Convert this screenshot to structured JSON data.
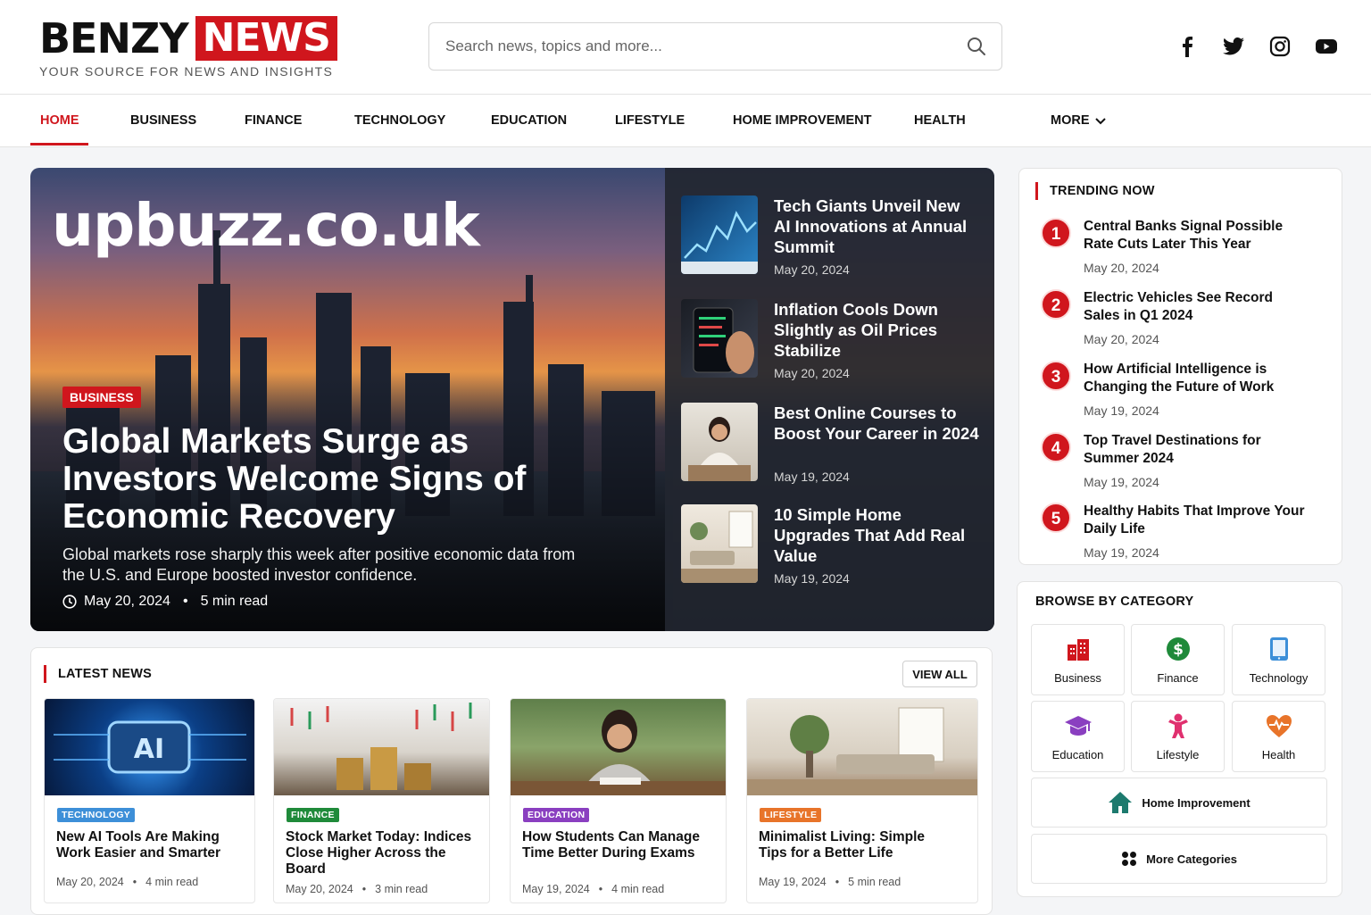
{
  "brand": {
    "name_dark": "BENZY",
    "name_red": "NEWS",
    "tagline": "YOUR SOURCE FOR NEWS AND INSIGHTS"
  },
  "search": {
    "placeholder": "Search news, topics and more..."
  },
  "social": [
    "facebook-icon",
    "twitter-icon",
    "instagram-icon",
    "youtube-icon"
  ],
  "nav": {
    "items": [
      "HOME",
      "BUSINESS",
      "FINANCE",
      "TECHNOLOGY",
      "EDUCATION",
      "LIFESTYLE",
      "HOME IMPROVEMENT",
      "HEALTH",
      "MORE"
    ],
    "active": "HOME"
  },
  "hero": {
    "watermark": "upbuzz.co.uk",
    "category": "BUSINESS",
    "title": "Global Markets Surge as Investors Welcome Signs of Economic Recovery",
    "description": "Global markets rose sharply this week after positive economic data from the U.S. and Europe boosted investor confidence.",
    "date": "May 20, 2024",
    "read_time": "5 min read",
    "side": [
      {
        "title": "Tech Giants Unveil New AI Innovations at Annual Summit",
        "date": "May 20, 2024"
      },
      {
        "title": "Inflation Cools Down Slightly as Oil Prices Stabilize",
        "date": "May 20, 2024"
      },
      {
        "title": "Best Online Courses to Boost Your Career in 2024",
        "date": "May 19, 2024"
      },
      {
        "title": "10 Simple Home Upgrades That Add Real Value",
        "date": "May 19, 2024"
      }
    ]
  },
  "latest": {
    "heading": "LATEST NEWS",
    "view_all": "VIEW ALL",
    "cards": [
      {
        "tag": "TECHNOLOGY",
        "title": "New AI Tools Are Making Work Easier and Smarter",
        "date": "May 20, 2024",
        "read": "4 min read"
      },
      {
        "tag": "FINANCE",
        "title": "Stock Market Today: Indices Close Higher Across the Board",
        "date": "May 20, 2024",
        "read": "3 min read"
      },
      {
        "tag": "EDUCATION",
        "title": "How Students Can Manage Time Better During Exams",
        "date": "May 19, 2024",
        "read": "4 min read"
      },
      {
        "tag": "LIFESTYLE",
        "title": "Minimalist Living: Simple Tips for a Better Life",
        "date": "May 19, 2024",
        "read": "5 min read"
      }
    ]
  },
  "trending": {
    "heading": "TRENDING NOW",
    "items": [
      {
        "num": "1",
        "title": "Central Banks Signal Possible Rate Cuts Later This Year",
        "date": "May 20, 2024"
      },
      {
        "num": "2",
        "title": "Electric Vehicles See Record Sales in Q1 2024",
        "date": "May 20, 2024"
      },
      {
        "num": "3",
        "title": "How Artificial Intelligence is Changing the Future of Work",
        "date": "May 19, 2024"
      },
      {
        "num": "4",
        "title": "Top Travel Destinations for Summer 2024",
        "date": "May 19, 2024"
      },
      {
        "num": "5",
        "title": "Healthy Habits That Improve Your Daily Life",
        "date": "May 19, 2024"
      }
    ]
  },
  "categories": {
    "heading": "BROWSE BY CATEGORY",
    "tiles": [
      "Business",
      "Finance",
      "Technology",
      "Education",
      "Lifestyle",
      "Health"
    ],
    "home_improvement": "Home Improvement",
    "more": "More Categories"
  },
  "colors": {
    "brand_red": "#d0161d",
    "technology": "#3d8fd8",
    "finance": "#1f8a3a",
    "education": "#8a3fc0",
    "lifestyle": "#e8742a",
    "lifestyle_icon": "#e0306f",
    "health": "#e8742a",
    "home_improvement": "#1d7a6e"
  }
}
